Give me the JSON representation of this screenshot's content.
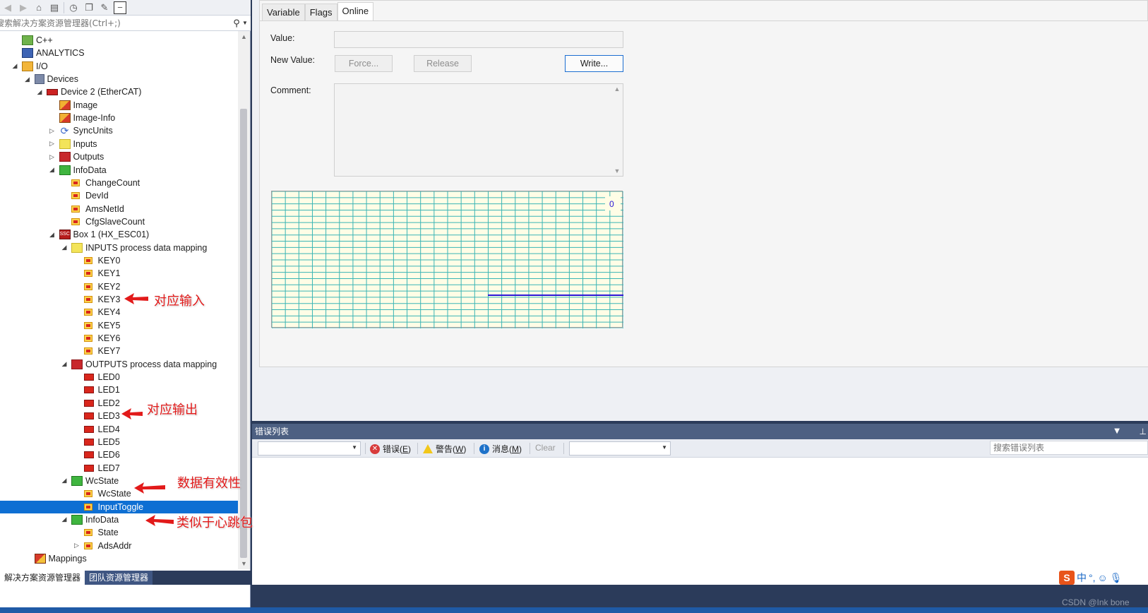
{
  "toolbar": {
    "icons": [
      "back-arrow-icon",
      "forward-arrow-icon",
      "home-icon",
      "tree-icon",
      "history-icon",
      "copy-icon",
      "wrench-icon",
      "minus-icon"
    ]
  },
  "search": {
    "placeholder": "搜索解决方案资源管理器(Ctrl+;)"
  },
  "tree": [
    {
      "label": "C++",
      "indent": 2,
      "arrow": "",
      "icon": "cpp"
    },
    {
      "label": "ANALYTICS",
      "indent": 2,
      "arrow": "",
      "icon": "analytics"
    },
    {
      "label": "I/O",
      "indent": 2,
      "arrow": "◢",
      "icon": "io"
    },
    {
      "label": "Devices",
      "indent": 3,
      "arrow": "◢",
      "icon": "devices"
    },
    {
      "label": "Device 2 (EtherCAT)",
      "indent": 4,
      "arrow": "◢",
      "icon": "device"
    },
    {
      "label": "Image",
      "indent": 5,
      "arrow": "",
      "icon": "img"
    },
    {
      "label": "Image-Info",
      "indent": 5,
      "arrow": "",
      "icon": "img"
    },
    {
      "label": "SyncUnits",
      "indent": 5,
      "arrow": "▷",
      "icon": "sync"
    },
    {
      "label": "Inputs",
      "indent": 5,
      "arrow": "▷",
      "icon": "yellow-folder"
    },
    {
      "label": "Outputs",
      "indent": 5,
      "arrow": "▷",
      "icon": "red-folder"
    },
    {
      "label": "InfoData",
      "indent": 5,
      "arrow": "◢",
      "icon": "green-folder"
    },
    {
      "label": "ChangeCount",
      "indent": 6,
      "arrow": "",
      "icon": "var"
    },
    {
      "label": "DevId",
      "indent": 6,
      "arrow": "",
      "icon": "var"
    },
    {
      "label": "AmsNetId",
      "indent": 6,
      "arrow": "",
      "icon": "var"
    },
    {
      "label": "CfgSlaveCount",
      "indent": 6,
      "arrow": "",
      "icon": "var"
    },
    {
      "label": "Box 1 (HX_ESC01)",
      "indent": 5,
      "arrow": "◢",
      "icon": "box"
    },
    {
      "label": "INPUTS process data mapping",
      "indent": 6,
      "arrow": "◢",
      "icon": "yellow-folder"
    },
    {
      "label": "KEY0",
      "indent": 7,
      "arrow": "",
      "icon": "var"
    },
    {
      "label": "KEY1",
      "indent": 7,
      "arrow": "",
      "icon": "var"
    },
    {
      "label": "KEY2",
      "indent": 7,
      "arrow": "",
      "icon": "var"
    },
    {
      "label": "KEY3",
      "indent": 7,
      "arrow": "",
      "icon": "var"
    },
    {
      "label": "KEY4",
      "indent": 7,
      "arrow": "",
      "icon": "var"
    },
    {
      "label": "KEY5",
      "indent": 7,
      "arrow": "",
      "icon": "var"
    },
    {
      "label": "KEY6",
      "indent": 7,
      "arrow": "",
      "icon": "var"
    },
    {
      "label": "KEY7",
      "indent": 7,
      "arrow": "",
      "icon": "var"
    },
    {
      "label": "OUTPUTS process data mapping",
      "indent": 6,
      "arrow": "◢",
      "icon": "red-folder"
    },
    {
      "label": "LED0",
      "indent": 7,
      "arrow": "",
      "icon": "outvar"
    },
    {
      "label": "LED1",
      "indent": 7,
      "arrow": "",
      "icon": "outvar"
    },
    {
      "label": "LED2",
      "indent": 7,
      "arrow": "",
      "icon": "outvar"
    },
    {
      "label": "LED3",
      "indent": 7,
      "arrow": "",
      "icon": "outvar"
    },
    {
      "label": "LED4",
      "indent": 7,
      "arrow": "",
      "icon": "outvar"
    },
    {
      "label": "LED5",
      "indent": 7,
      "arrow": "",
      "icon": "outvar"
    },
    {
      "label": "LED6",
      "indent": 7,
      "arrow": "",
      "icon": "outvar"
    },
    {
      "label": "LED7",
      "indent": 7,
      "arrow": "",
      "icon": "outvar"
    },
    {
      "label": "WcState",
      "indent": 6,
      "arrow": "◢",
      "icon": "green-folder"
    },
    {
      "label": "WcState",
      "indent": 7,
      "arrow": "",
      "icon": "var"
    },
    {
      "label": "InputToggle",
      "indent": 7,
      "arrow": "",
      "icon": "var",
      "selected": true
    },
    {
      "label": "InfoData",
      "indent": 6,
      "arrow": "◢",
      "icon": "green-folder"
    },
    {
      "label": "State",
      "indent": 7,
      "arrow": "",
      "icon": "var"
    },
    {
      "label": "AdsAddr",
      "indent": 7,
      "arrow": "▷",
      "icon": "var"
    },
    {
      "label": "Mappings",
      "indent": 3,
      "arrow": "",
      "icon": "mapping"
    }
  ],
  "bottom_tabs": [
    "解决方案资源管理器",
    "团队资源管理器"
  ],
  "prop_tabs": [
    "Variable",
    "Flags",
    "Online"
  ],
  "online": {
    "value_label": "Value:",
    "value": "",
    "new_value_label": "New Value:",
    "force_label": "Force...",
    "release_label": "Release",
    "write_label": "Write...",
    "comment_label": "Comment:",
    "comment": ""
  },
  "chart": {
    "readout": "0",
    "line_color": "#2a16d6",
    "grid_color": "#3ab5b5",
    "bg_color": "#fffde6"
  },
  "error_list": {
    "title": "错误列表",
    "errors_label": "错误(",
    "errors_key": "E",
    "warnings_label": "警告(",
    "warnings_key": "W",
    "messages_label": "消息(",
    "messages_key": "M",
    "clear_label": "Clear",
    "search_placeholder": "搜索错误列表"
  },
  "annotations": [
    "对应输入",
    "对应输出",
    "数据有效性",
    "类似于心跳包"
  ],
  "ime": {
    "logo": "S",
    "lang": "中",
    "symbols": "°,"
  },
  "watermark": "CSDN @Ink bone"
}
